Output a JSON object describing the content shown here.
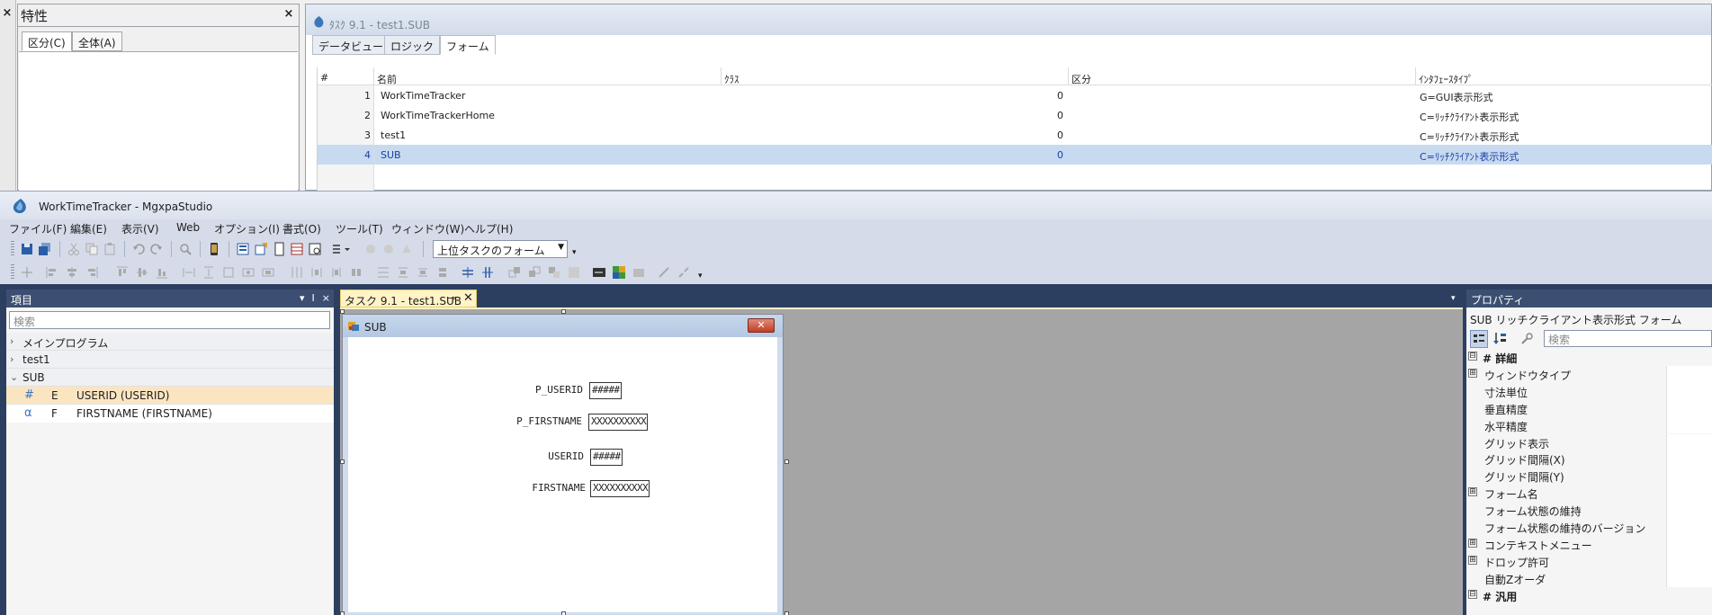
{
  "top_float": {
    "left_close": "×",
    "props": {
      "title": "特性",
      "close": "×",
      "tabs": [
        "区分(C)",
        "全体(A)"
      ]
    },
    "task_window": {
      "title": "ﾀｽｸ 9.1 -   test1.SUB",
      "tabs": [
        "データビュー",
        "ロジック",
        "フォーム"
      ],
      "active_tab": "フォーム",
      "columns": [
        "#",
        "名前",
        "ｸﾗｽ",
        "区分",
        "ｲﾝﾀﾌｪｰｽﾀｲﾌﾟ"
      ],
      "rows": [
        {
          "num": "1",
          "name": "WorkTimeTracker",
          "class_val": "0",
          "iface": "G=GUI表示形式"
        },
        {
          "num": "2",
          "name": "WorkTimeTrackerHome",
          "class_val": "0",
          "iface": "C=ﾘｯﾁｸﾗｲｱﾝﾄ表示形式"
        },
        {
          "num": "3",
          "name": "test1",
          "class_val": "0",
          "iface": "C=ﾘｯﾁｸﾗｲｱﾝﾄ表示形式"
        },
        {
          "num": "4",
          "name": "SUB",
          "class_val": "0",
          "iface": "C=ﾘｯﾁｸﾗｲｱﾝﾄ表示形式"
        }
      ],
      "selected_row": 4
    }
  },
  "app": {
    "title": "WorkTimeTracker - MgxpaStudio",
    "menu": [
      "ファイル(F)",
      "編集(E)",
      "表示(V)",
      "Web",
      "オプション(I)",
      "書式(O)",
      "ツール(T)",
      "ウィンドウ(W)",
      "ヘルプ(H)"
    ],
    "form_combo": "上位タスクのフォーム"
  },
  "items_pane": {
    "title": "項目",
    "header_btns": [
      "▾",
      "ⵏ",
      "×"
    ],
    "search_placeholder": "検索",
    "tree": [
      {
        "arrow": "›",
        "label": "メインプログラム"
      },
      {
        "arrow": "›",
        "label": "test1"
      },
      {
        "arrow": "⌄",
        "label": "SUB"
      }
    ],
    "children": [
      {
        "sym": "#",
        "type": "E",
        "label": "USERID (USERID)"
      },
      {
        "sym": "α",
        "type": "F",
        "label": "FIRSTNAME (FIRSTNAME)"
      }
    ]
  },
  "document": {
    "tab_label": "タスク 9.1 - test1.SUB",
    "tab_pin": "⊸",
    "tab_close": "✕",
    "overflow": "▾",
    "form": {
      "title": "SUB",
      "close": "✕",
      "fields": [
        {
          "label": "P_USERID",
          "value": "#####"
        },
        {
          "label": "P_FIRSTNAME",
          "value": "XXXXXXXXXX"
        },
        {
          "label": "USERID",
          "value": "#####"
        },
        {
          "label": "FIRSTNAME",
          "value": "XXXXXXXXXX"
        }
      ]
    }
  },
  "props_pane": {
    "title": "プロパティ",
    "subtitle": "SUB  リッチクライアント表示形式 フォーム",
    "search_placeholder": "検索",
    "rows": [
      {
        "exp": "⊟",
        "label": "# 詳細",
        "cat": true
      },
      {
        "exp": "⊞",
        "label": "ウィンドウタイプ",
        "cat": false
      },
      {
        "exp": "",
        "label": "寸法単位",
        "cat": false
      },
      {
        "exp": "",
        "label": "垂直精度",
        "cat": false
      },
      {
        "exp": "",
        "label": "水平精度",
        "cat": false
      },
      {
        "exp": "",
        "label": "グリッド表示",
        "cat": false
      },
      {
        "exp": "",
        "label": "グリッド間隔(X)",
        "cat": false
      },
      {
        "exp": "",
        "label": "グリッド間隔(Y)",
        "cat": false
      },
      {
        "exp": "⊞",
        "label": "フォーム名",
        "cat": false
      },
      {
        "exp": "",
        "label": "フォーム状態の維持",
        "cat": false
      },
      {
        "exp": "",
        "label": "フォーム状態の維持のバージョン",
        "cat": false
      },
      {
        "exp": "⊞",
        "label": "コンテキストメニュー",
        "cat": false
      },
      {
        "exp": "⊞",
        "label": "ドロップ許可",
        "cat": false
      },
      {
        "exp": "",
        "label": "自動Zオーダ",
        "cat": false
      },
      {
        "exp": "⊟",
        "label": "# 汎用",
        "cat": true
      }
    ]
  },
  "colors": {
    "dock": "#2d3f61",
    "pane_header": "#3c4f72",
    "selection": "#c8daef",
    "active_tab": "#fff3c7"
  }
}
